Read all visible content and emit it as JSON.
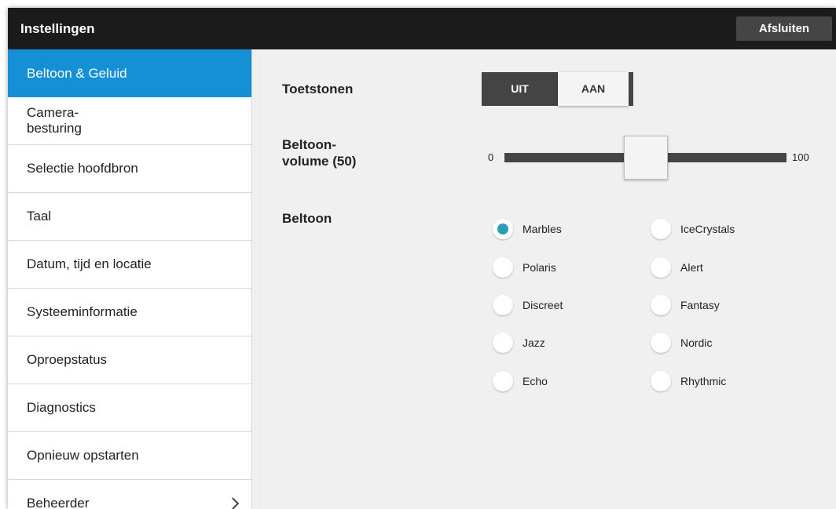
{
  "header": {
    "title": "Instellingen",
    "close_label": "Afsluiten"
  },
  "sidebar": {
    "items": [
      {
        "label": "Beltoon & Geluid",
        "active": true
      },
      {
        "label": "Camera-\nbesturing"
      },
      {
        "label": "Selectie hoofdbron"
      },
      {
        "label": "Taal"
      },
      {
        "label": "Datum, tijd  en locatie"
      },
      {
        "label": "Systeeminformatie"
      },
      {
        "label": "Oproepstatus"
      },
      {
        "label": "Diagnostics"
      },
      {
        "label": "Opnieuw opstarten"
      },
      {
        "label": "Beheerder",
        "has_submenu": true
      }
    ]
  },
  "settings": {
    "key_tones": {
      "label": "Toetstonen",
      "off_label": "UIT",
      "on_label": "AAN",
      "selected": "AAN"
    },
    "ring_volume": {
      "label": "Beltoon-\nvolume (50)",
      "min_label": "0",
      "max_label": "100",
      "value": 50,
      "min": 0,
      "max": 100
    },
    "ringtone": {
      "label": "Beltoon",
      "options_left": [
        "Marbles",
        "Polaris",
        "Discreet",
        "Jazz",
        "Echo"
      ],
      "options_right": [
        "IceCrystals",
        "Alert",
        "Fantasy",
        "Nordic",
        "Rhythmic"
      ],
      "selected": "Marbles"
    }
  },
  "colors": {
    "accent": "#1590d6",
    "radio_selected": "#2a9fb4",
    "topbar": "#1b1b1b"
  }
}
